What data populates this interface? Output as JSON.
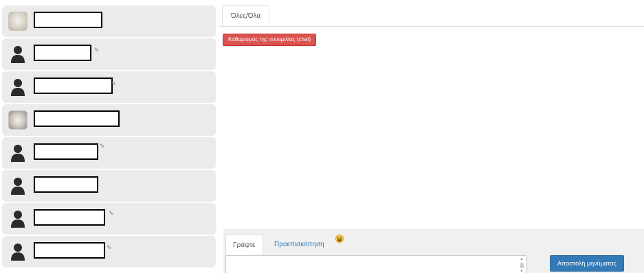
{
  "chat": {
    "tabs": [
      {
        "label": "Όλες/Όλα"
      }
    ],
    "clear_button_label": "Καθαρισμός της συνομιλίας (chat)"
  },
  "composer": {
    "tabs": [
      {
        "label": "Γράψτε"
      },
      {
        "label": "Προεπισκόπηση"
      }
    ],
    "emoji_icon": "smiley-icon",
    "send_button_label": "Αποστολή μηνύματος",
    "message_value": ""
  },
  "users": [
    {
      "avatar": "photo",
      "status": false
    },
    {
      "avatar": "silhouette",
      "status": true
    },
    {
      "avatar": "silhouette",
      "status": true
    },
    {
      "avatar": "photo",
      "status": false
    },
    {
      "avatar": "silhouette",
      "status": true
    },
    {
      "avatar": "silhouette",
      "status": false
    },
    {
      "avatar": "silhouette",
      "status": true
    },
    {
      "avatar": "silhouette",
      "status": true
    }
  ],
  "colors": {
    "danger": "#d9534f",
    "primary": "#337ab7",
    "link": "#337ab7",
    "sidebar_item": "#ebebeb"
  }
}
